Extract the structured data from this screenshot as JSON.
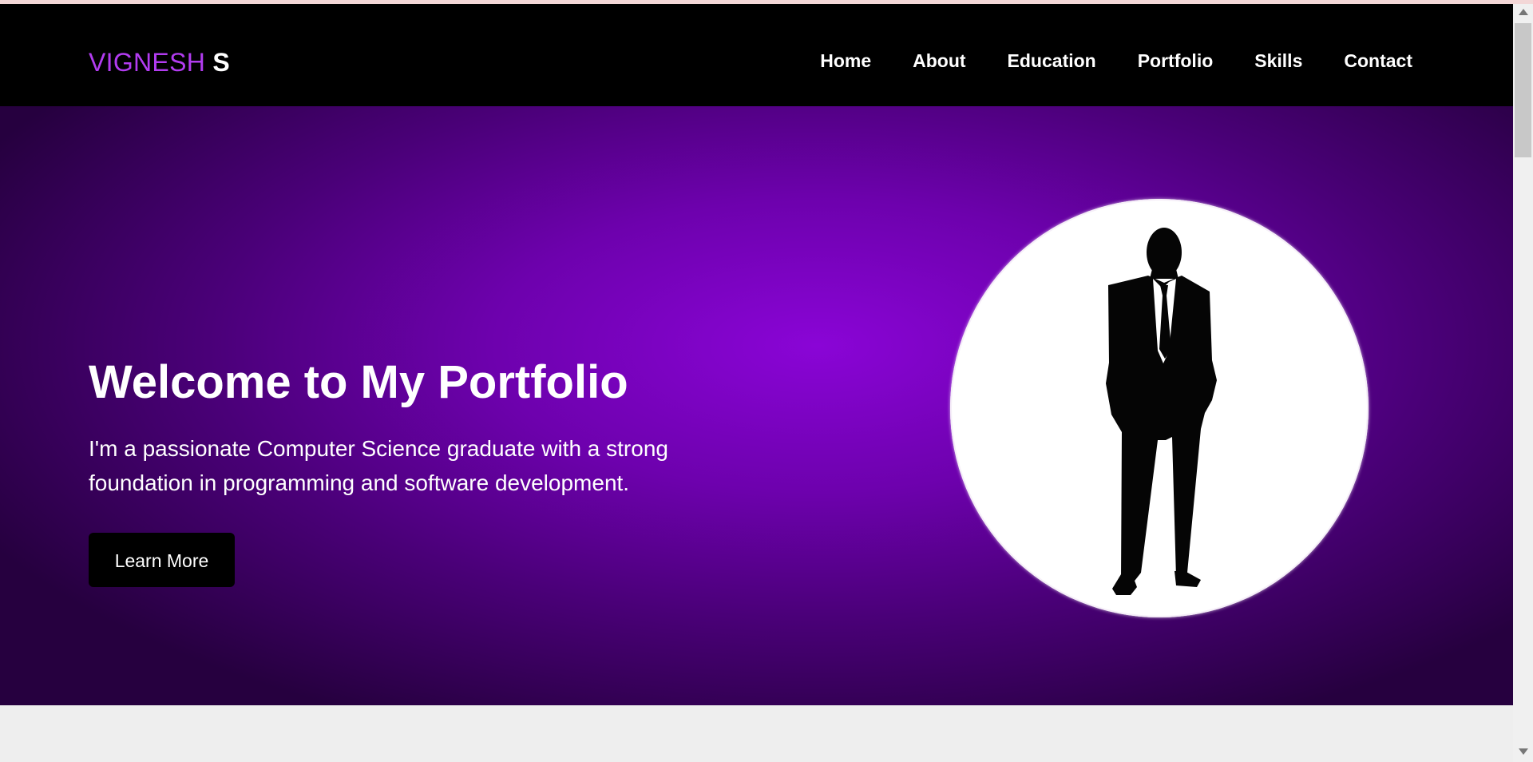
{
  "logo": {
    "first": "VIGNESH",
    "last": "S"
  },
  "nav": {
    "items": [
      {
        "label": "Home"
      },
      {
        "label": "About"
      },
      {
        "label": "Education"
      },
      {
        "label": "Portfolio"
      },
      {
        "label": "Skills"
      },
      {
        "label": "Contact"
      }
    ]
  },
  "hero": {
    "title": "Welcome to My Portfolio",
    "text_line1": "I'm a passionate Computer Science graduate with a strong",
    "text_line2": "foundation in programming and software development.",
    "button_label": "Learn More",
    "image": "person-silhouette"
  },
  "colors": {
    "accent": "#b23cf0",
    "hero_center": "#8a05d6",
    "hero_edge": "#26003f",
    "nav_background": "#000000",
    "button_background": "#000000"
  },
  "icons": {
    "scroll_up": "arrow-up-icon",
    "scroll_down": "arrow-down-icon"
  }
}
